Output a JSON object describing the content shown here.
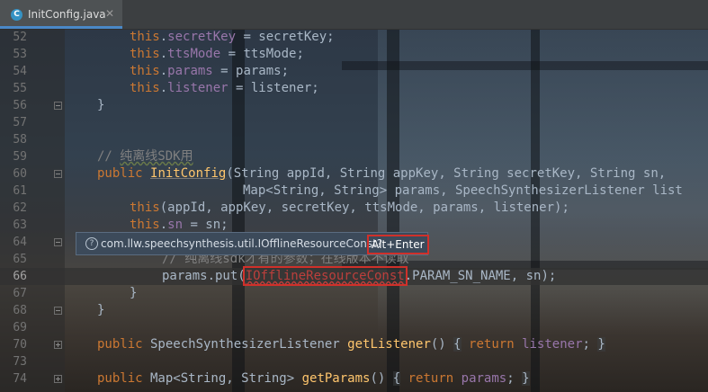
{
  "tab": {
    "icon": "class-c-icon",
    "letter": "C",
    "label": "InitConfig.java",
    "close": "✕"
  },
  "tooltip": {
    "question": "?",
    "text": "com.llw.speechsynthesis.util.IOfflineResourceConst?",
    "shortcut": "Alt+Enter"
  },
  "lines": [
    {
      "num": "52",
      "code": [
        "this",
        ".",
        "secretKey",
        " = secretKey;"
      ]
    },
    {
      "num": "53",
      "code": [
        "this",
        ".",
        "ttsMode",
        " = ttsMode;"
      ]
    },
    {
      "num": "54",
      "code": [
        "this",
        ".",
        "params",
        " = params;"
      ]
    },
    {
      "num": "55",
      "code": [
        "this",
        ".",
        "listener",
        " = listener;"
      ]
    },
    {
      "num": "56",
      "code": [
        "}"
      ]
    },
    {
      "num": "57",
      "code": []
    },
    {
      "num": "58",
      "code": []
    },
    {
      "num": "59",
      "code": [
        "// ",
        "纯离线SDK用"
      ]
    },
    {
      "num": "60",
      "code": [
        "public",
        " ",
        "InitConfig",
        "(String appId, String appKey, String secretKey, String sn,"
      ]
    },
    {
      "num": "61",
      "code": [
        "Map<String, String> params, SpeechSynthesizerListener list"
      ]
    },
    {
      "num": "62",
      "code": [
        "this",
        "(appId, appKey, secretKey, ttsMode, params, listener);"
      ]
    },
    {
      "num": "63",
      "code": [
        "this",
        ".",
        "sn",
        " = sn;"
      ]
    },
    {
      "num": "64",
      "code": []
    },
    {
      "num": "65",
      "code": [
        "// 纯离线sdk才有的参数；在线版本不读取"
      ]
    },
    {
      "num": "66",
      "code": [
        "params.put(",
        "IOfflineResourceConst",
        ".PARAM_SN_NAME, sn);"
      ]
    },
    {
      "num": "67",
      "code": [
        "}"
      ]
    },
    {
      "num": "68",
      "code": [
        "}"
      ]
    },
    {
      "num": "69",
      "code": []
    },
    {
      "num": "70",
      "code": [
        "public",
        " SpeechSynthesizerListener ",
        "getListener",
        "() ",
        "{",
        " ",
        "return",
        " ",
        "listener",
        "; ",
        "}"
      ]
    },
    {
      "num": "73",
      "code": []
    },
    {
      "num": "74",
      "code": [
        "public",
        " Map<String, String> ",
        "getParams",
        "() ",
        "{",
        " ",
        "return",
        " ",
        "params",
        "; ",
        "}"
      ]
    }
  ]
}
